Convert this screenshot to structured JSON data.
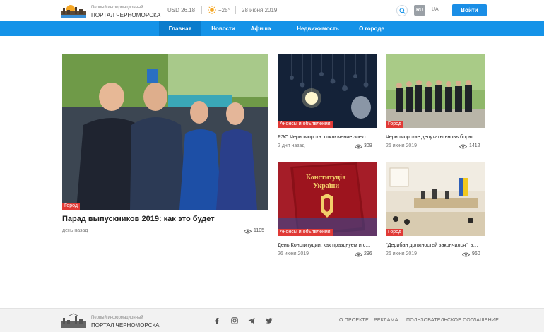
{
  "brand": {
    "line1": "Первый информационный",
    "line2": "ПОРТАЛ ЧЕРНОМОРСКА"
  },
  "header": {
    "currency": "USD 26.18",
    "temperature": "+25°",
    "date": "28 июня 2019",
    "lang_active": "RU",
    "lang_other": "UA",
    "login_label": "Войти"
  },
  "nav": {
    "items": [
      {
        "label": "Главная",
        "active": true
      },
      {
        "label": "Новости",
        "active": false
      },
      {
        "label": "Афиша",
        "active": false
      },
      {
        "label": "Недвижимость",
        "active": false
      },
      {
        "label": "О городе",
        "active": false
      }
    ]
  },
  "lead": {
    "tag": "Город",
    "title": "Парад выпускников 2019: как это будет",
    "date": "день назад",
    "views": "1105"
  },
  "cards": [
    {
      "tag": "Анонсы и объявления",
      "title": "РЭС Черноморска: отключение элект…",
      "date": "2 дня назад",
      "views": "309"
    },
    {
      "tag": "Город",
      "title": "Черноморские депутаты вновь борю…",
      "date": "26 июня 2019",
      "views": "1412"
    },
    {
      "tag": "Анонсы и объявления",
      "title": "День Конституции: как празднуем и с…",
      "date": "26 июня 2019",
      "views": "296"
    },
    {
      "tag": "Город",
      "title": "\"Дерибан должностей закончился\": в…",
      "date": "26 июня 2019",
      "views": "960"
    }
  ],
  "constitution_text": {
    "line1": "Конституція",
    "line2": "України"
  },
  "footer": {
    "links": [
      "О ПРОЕКТЕ",
      "РЕКЛАМА",
      "ПОЛЬЗОВАТЕЛЬСКОЕ СОГЛАШЕНИЕ"
    ],
    "social": [
      "facebook-icon",
      "instagram-icon",
      "telegram-icon",
      "twitter-icon"
    ]
  },
  "colors": {
    "accent": "#1593e8",
    "tag": "#e03a36",
    "login": "#1a8ee6"
  }
}
